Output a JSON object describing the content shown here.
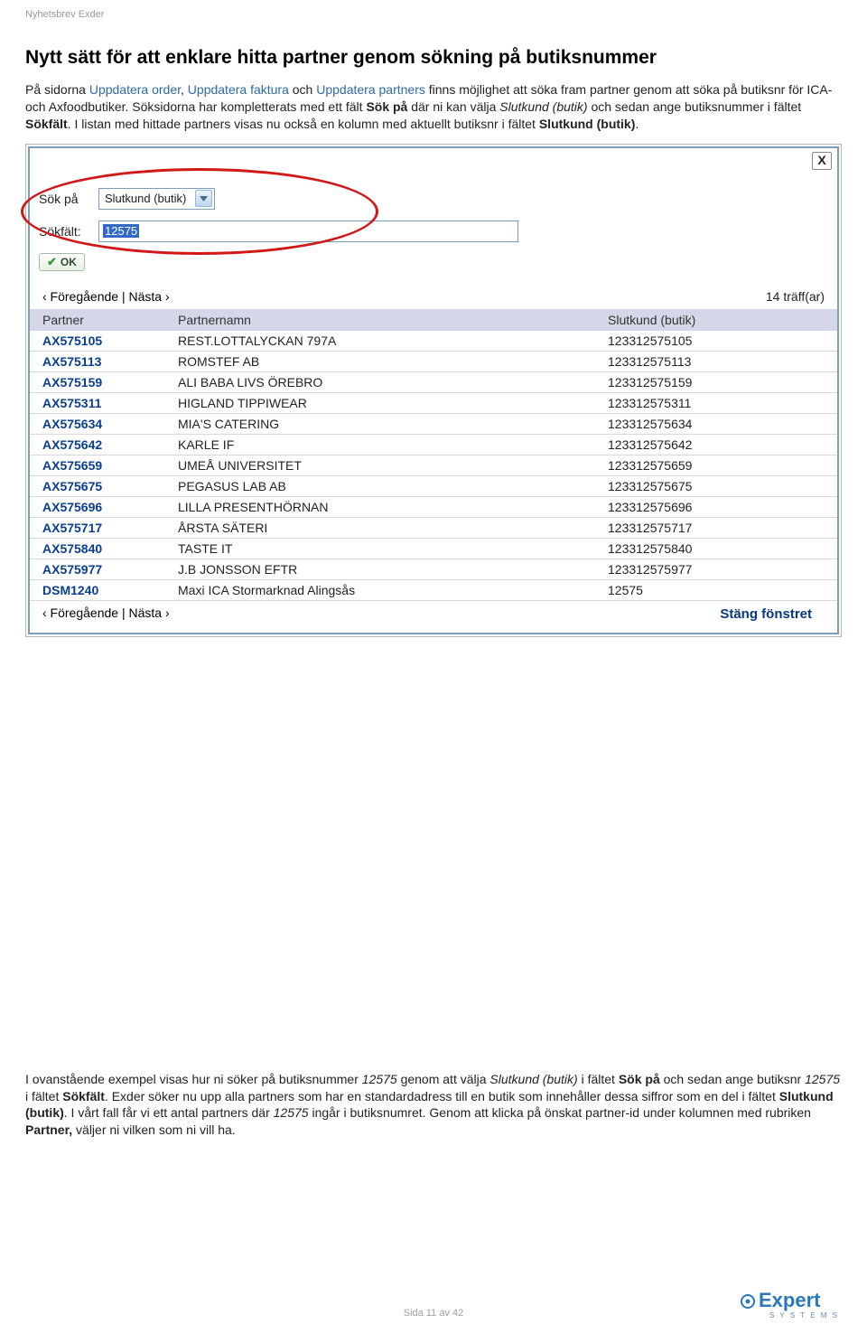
{
  "doc_header": "Nyhetsbrev Exder",
  "heading": "Nytt sätt för att enklare hitta partner genom sökning på butiksnummer",
  "intro": {
    "p1_a": "På sidorna ",
    "link1": "Uppdatera order",
    "p1_b": ", ",
    "link2": "Uppdatera faktura",
    "p1_c": " och ",
    "link3": "Uppdatera partners",
    "p1_d": " finns möjlighet att söka fram partner genom att söka på butiksnr för ICA- och Axfoodbutiker. Söksidorna har kompletterats med ett fält ",
    "b1": "Sök på",
    "p1_e": " där ni kan välja ",
    "i1": "Slutkund (butik)",
    "p1_f": " och sedan ange butiksnummer i fältet ",
    "b2": "Sökfält",
    "p1_g": ". I listan med hittade partners visas nu också en kolumn med aktuellt butiksnr i fältet ",
    "b3": "Slutkund (butik)",
    "p1_h": "."
  },
  "search": {
    "label_sokpa": "Sök på",
    "select_value": "Slutkund (butik)",
    "label_sokfalt": "Sökfält:",
    "input_value": "12575",
    "ok_label": "OK",
    "close_label": "X"
  },
  "pager": {
    "prev": "‹ Föregående",
    "sep": " | ",
    "next": "Nästa ›",
    "hits": "14 träff(ar)"
  },
  "table": {
    "head_partner": "Partner",
    "head_name": "Partnernamn",
    "head_butik": "Slutkund (butik)",
    "rows": [
      {
        "partner": "AX575105",
        "name": "REST.LOTTALYCKAN 797A",
        "butik": "123312575105"
      },
      {
        "partner": "AX575113",
        "name": "ROMSTEF AB",
        "butik": "123312575113"
      },
      {
        "partner": "AX575159",
        "name": "ALI BABA LIVS ÖREBRO",
        "butik": "123312575159"
      },
      {
        "partner": "AX575311",
        "name": "HIGLAND TIPPIWEAR",
        "butik": "123312575311"
      },
      {
        "partner": "AX575634",
        "name": "MIA'S CATERING",
        "butik": "123312575634"
      },
      {
        "partner": "AX575642",
        "name": "KARLE IF",
        "butik": "123312575642"
      },
      {
        "partner": "AX575659",
        "name": "UMEÅ UNIVERSITET",
        "butik": "123312575659"
      },
      {
        "partner": "AX575675",
        "name": "PEGASUS LAB AB",
        "butik": "123312575675"
      },
      {
        "partner": "AX575696",
        "name": "LILLA PRESENTHÖRNAN",
        "butik": "123312575696"
      },
      {
        "partner": "AX575717",
        "name": "ÅRSTA SÄTERI",
        "butik": "123312575717"
      },
      {
        "partner": "AX575840",
        "name": "TASTE IT",
        "butik": "123312575840"
      },
      {
        "partner": "AX575977",
        "name": "J.B JONSSON EFTR",
        "butik": "123312575977"
      },
      {
        "partner": "DSM1240",
        "name": "Maxi ICA Stormarknad Alingsås",
        "butik": "12575"
      }
    ],
    "close_window": "Stäng fönstret"
  },
  "below": {
    "a": "I ovanstående exempel visas hur ni söker på butiksnummer ",
    "i1": "12575",
    "b": " genom att välja ",
    "i2": "Slutkund (butik)",
    "c": " i fältet ",
    "b1": "Sök på",
    "d": " och sedan ange butiksnr ",
    "i3": "12575",
    "e": " i fältet ",
    "b2": "Sökfält",
    "f": ". Exder söker nu upp alla partners som har en standardadress till en butik som innehåller dessa siffror som en del i fältet ",
    "b3": "Slutkund (butik)",
    "g": ". I vårt fall får vi ett antal partners där ",
    "i4": "12575",
    "h": " ingår i butiksnumret. Genom att klicka på önskat partner-id under kolumnen med rubriken ",
    "b4": "Partner,",
    "i": " väljer ni vilken som ni vill ha."
  },
  "footer_page": "Sida 11 av 42",
  "logo_top": "Expert",
  "logo_sub": "S Y S T E M S"
}
